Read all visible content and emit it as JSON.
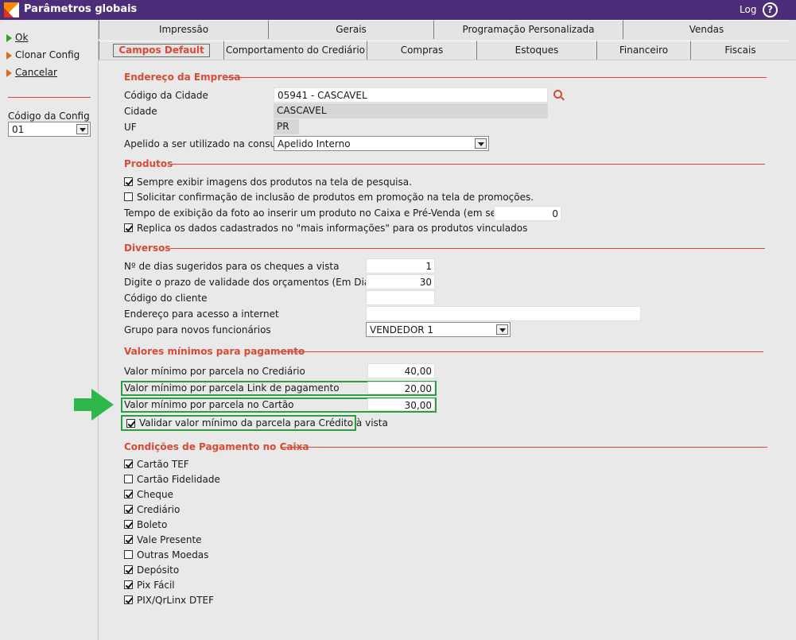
{
  "window": {
    "title": "Parâmetros globais",
    "log_label": "Log",
    "help_glyph": "?"
  },
  "sidebar": {
    "actions": [
      {
        "label": "Ok",
        "icon": "green-triangle-icon"
      },
      {
        "label": "Clonar Config",
        "icon": "orange-triangle-icon"
      },
      {
        "label": "Cancelar",
        "icon": "orange-triangle-icon"
      }
    ],
    "config_label": "Código da Config",
    "config_value": "01"
  },
  "tabs": {
    "row1": [
      "Impressão",
      "Gerais",
      "Programação Personalizada",
      "Vendas"
    ],
    "row2": [
      "Campos Default",
      "Comportamento do Crediário",
      "Compras",
      "Estoques",
      "Financeiro",
      "Fiscais"
    ],
    "active": "Campos Default"
  },
  "endereco": {
    "title": "Endereço da Empresa",
    "codigo_cidade_label": "Código da Cidade",
    "codigo_cidade_value": "05941 - CASCAVEL",
    "cidade_label": "Cidade",
    "cidade_value": "CASCAVEL",
    "uf_label": "UF",
    "uf_value": "PR",
    "apelido_label": "Apelido a ser utilizado na consulta",
    "apelido_value": "Apelido Interno"
  },
  "produtos": {
    "title": "Produtos",
    "exibir_imagens": {
      "label": "Sempre exibir imagens dos produtos na tela de pesquisa.",
      "checked": true
    },
    "solicitar_confirmacao": {
      "label": "Solicitar confirmação de inclusão de produtos em promoção na tela de promoções.",
      "checked": false
    },
    "tempo_foto_label": "Tempo de exibição da foto ao inserir um produto no Caixa e Pré-Venda (em segundos):",
    "tempo_foto_value": "0",
    "replica_dados": {
      "label": "Replica os dados cadastrados no \"mais informações\" para os produtos vinculados",
      "checked": true
    }
  },
  "diversos": {
    "title": "Diversos",
    "dias_cheques_label": "Nº de dias sugeridos para os cheques a vista",
    "dias_cheques_value": "1",
    "validade_orcamentos_label": "Digite o prazo de validade dos orçamentos (Em Dias)",
    "validade_orcamentos_value": "30",
    "codigo_cliente_label": "Código do cliente",
    "codigo_cliente_value": "",
    "endereco_internet_label": "Endereço para acesso a internet",
    "endereco_internet_value": "",
    "grupo_funcionarios_label": "Grupo para novos funcionários",
    "grupo_funcionarios_value": "VENDEDOR 1"
  },
  "valores_minimos": {
    "title": "Valores mínimos para pagamento",
    "crediario_label": "Valor mínimo por parcela no Crediário",
    "crediario_value": "40,00",
    "link_label": "Valor mínimo por parcela Link de pagamento",
    "link_value": "20,00",
    "cartao_label": "Valor mínimo por parcela no Cartão",
    "cartao_value": "30,00",
    "validar_credito": {
      "label": "Validar valor mínimo da parcela para Crédito à vista",
      "checked": true
    }
  },
  "condicoes": {
    "title": "Condições de Pagamento no Caixa",
    "items": [
      {
        "label": "Cartão TEF",
        "checked": true
      },
      {
        "label": "Cartão Fidelidade",
        "checked": false
      },
      {
        "label": "Cheque",
        "checked": true
      },
      {
        "label": "Crediário",
        "checked": true
      },
      {
        "label": "Boleto",
        "checked": true
      },
      {
        "label": "Vale Presente",
        "checked": true
      },
      {
        "label": "Outras Moedas",
        "checked": false
      },
      {
        "label": "Depósito",
        "checked": true
      },
      {
        "label": "Pix Fácil",
        "checked": true
      },
      {
        "label": "PIX/QrLinx DTEF",
        "checked": true
      }
    ]
  },
  "colors": {
    "titlebar": "#4b2d7a",
    "accent": "#d94a36",
    "highlight": "#2e9e44"
  }
}
